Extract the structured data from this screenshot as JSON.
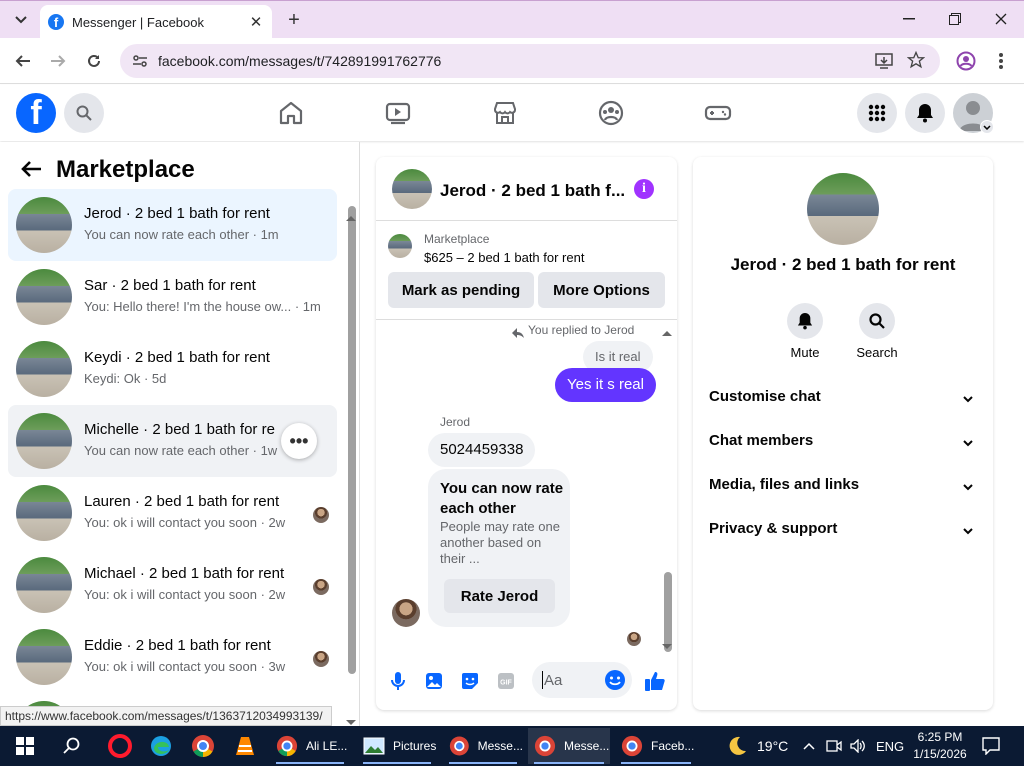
{
  "browser": {
    "tab_title": "Messenger | Facebook",
    "url": "facebook.com/messages/t/742891991762776",
    "status_url": "https://www.facebook.com/messages/t/1363712034993139/"
  },
  "left": {
    "title": "Marketplace",
    "conversations": [
      {
        "name": "Jerod · 2 bed 1 bath for rent",
        "preview": "You can now rate each other · 1m"
      },
      {
        "name": "Sar · 2 bed 1 bath for rent",
        "preview": "You: Hello there! I'm the house ow... · 1m"
      },
      {
        "name": "Keydi · 2 bed 1 bath for rent",
        "preview": "Keydi: Ok · 5d"
      },
      {
        "name": "Michelle · 2 bed 1 bath for re",
        "preview": "You can now rate each other · 1w"
      },
      {
        "name": "Lauren · 2 bed 1 bath for rent",
        "preview": "You: ok i will contact you soon · 2w"
      },
      {
        "name": "Michael · 2 bed 1 bath for rent",
        "preview": "You: ok i will contact you soon · 2w"
      },
      {
        "name": "Eddie · 2 bed 1 bath for rent",
        "preview": "You: ok i will contact you soon · 3w"
      }
    ],
    "more_label": "•••"
  },
  "chat": {
    "title": "Jerod · 2 bed 1 bath f...",
    "marketplace_label": "Marketplace",
    "listing": "$625 – 2 bed 1 bath for rent",
    "btn_pending": "Mark as pending",
    "btn_more": "More Options",
    "replied_note": "You replied to Jerod",
    "quoted_msg": "Is it real",
    "my_msg": "Yes it s real",
    "sender_name": "Jerod",
    "their_msg": "5024459338",
    "rate_title": "You can now rate each other",
    "rate_body": "People may rate one another based on their ...",
    "rate_btn": "Rate Jerod",
    "input_placeholder": "Aa"
  },
  "right": {
    "title": "Jerod · 2 bed 1 bath for rent",
    "mute": "Mute",
    "search": "Search",
    "rows": [
      "Customise chat",
      "Chat members",
      "Media, files and links",
      "Privacy & support"
    ]
  },
  "taskbar": {
    "items": [
      "Ali LE...",
      "Pictures",
      "Messe...",
      "Messe...",
      "Faceb..."
    ],
    "weather": "19°C",
    "lang": "ENG",
    "time": "6:25 PM",
    "date": "1/15/2026"
  },
  "colors": {
    "fb_blue": "#0866ff",
    "my_bubble": "#6335ff",
    "info_purple": "#a033ff",
    "active_row": "#ebf5ff"
  }
}
